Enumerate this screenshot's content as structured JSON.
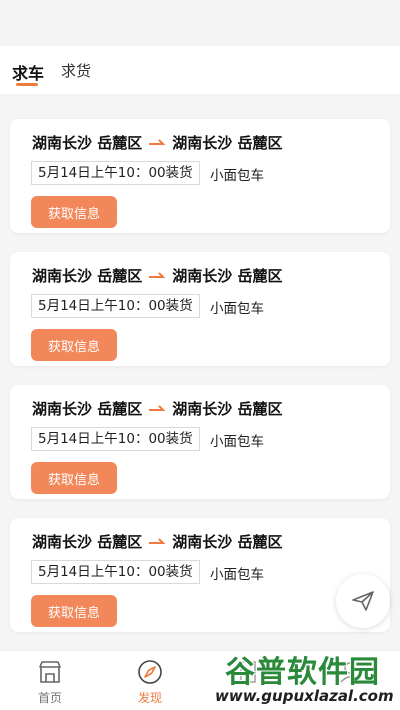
{
  "tabs": [
    {
      "label": "求车",
      "active": true
    },
    {
      "label": "求货",
      "active": false
    }
  ],
  "cards": [
    {
      "from": "湖南长沙 岳麓区",
      "to": "湖南长沙 岳麓区",
      "time": "5月14日上午10：00装货",
      "vehicle": "小面包车",
      "button": "获取信息"
    },
    {
      "from": "湖南长沙 岳麓区",
      "to": "湖南长沙 岳麓区",
      "time": "5月14日上午10：00装货",
      "vehicle": "小面包车",
      "button": "获取信息"
    },
    {
      "from": "湖南长沙 岳麓区",
      "to": "湖南长沙 岳麓区",
      "time": "5月14日上午10：00装货",
      "vehicle": "小面包车",
      "button": "获取信息"
    },
    {
      "from": "湖南长沙 岳麓区",
      "to": "湖南长沙 岳麓区",
      "time": "5月14日上午10：00装货",
      "vehicle": "小面包车",
      "button": "获取信息"
    }
  ],
  "nav": {
    "home": "首页",
    "discover": "发现"
  },
  "watermark": {
    "title": "谷普软件园",
    "url": "www.gupuxlazal.com"
  },
  "colors": {
    "accent": "#ee7a40",
    "button": "#f2875a"
  }
}
